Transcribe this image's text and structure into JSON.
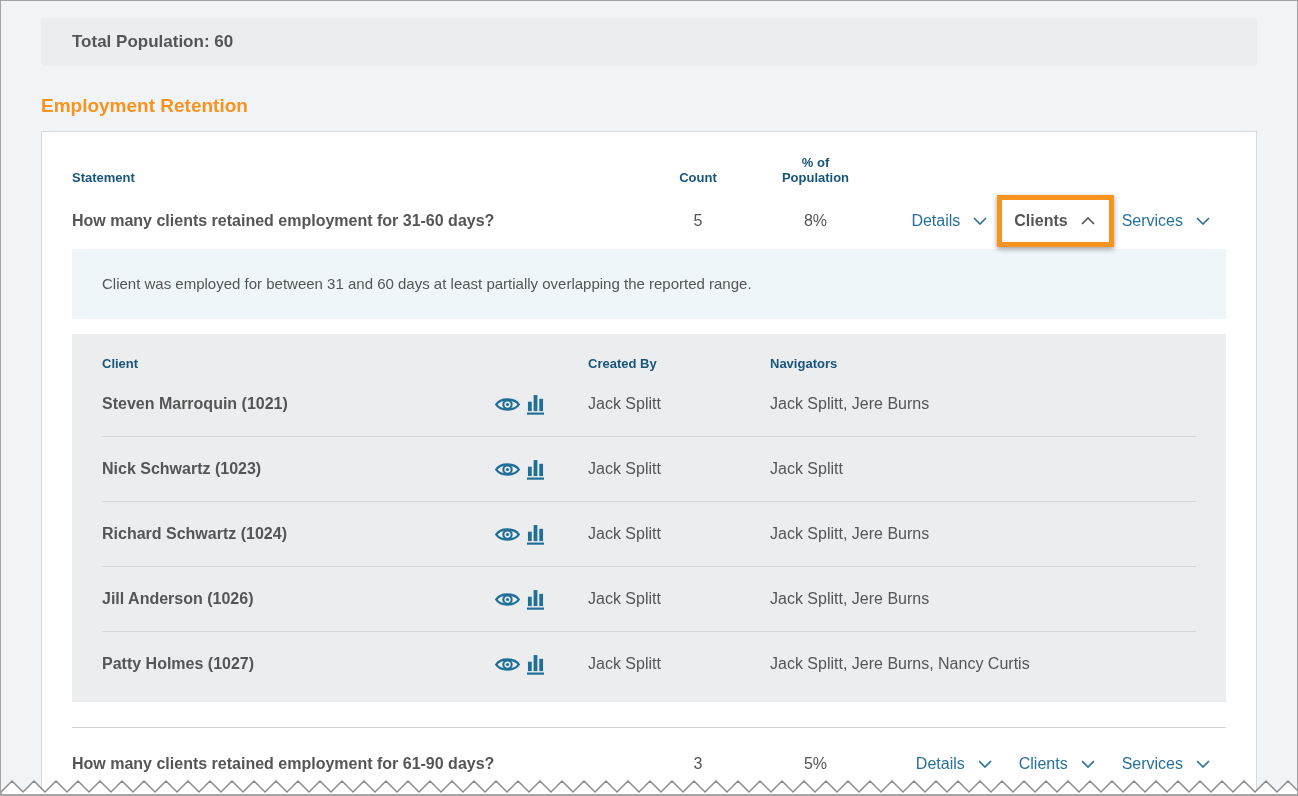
{
  "summary": {
    "label": "Total Population: 60"
  },
  "section_title": "Employment Retention",
  "columns": [
    "Statement",
    "Count",
    "% of Population"
  ],
  "statements": [
    {
      "text": "How many clients retained employment for 31-60 days?",
      "count": "5",
      "percent": "8%",
      "toggles": [
        {
          "label": "Details",
          "expanded": false,
          "highlighted": false
        },
        {
          "label": "Clients",
          "expanded": true,
          "highlighted": true
        },
        {
          "label": "Services",
          "expanded": false,
          "highlighted": false
        }
      ],
      "description": "Client was employed for between 31 and 60 days at least partially overlapping the reported range.",
      "clients": {
        "columns": [
          "Client",
          "Created By",
          "Navigators"
        ],
        "rows": [
          {
            "name": "Steven Marroquin (1021)",
            "created_by": "Jack Splitt",
            "navigators": "Jack Splitt, Jere Burns"
          },
          {
            "name": "Nick Schwartz (1023)",
            "created_by": "Jack Splitt",
            "navigators": "Jack Splitt"
          },
          {
            "name": "Richard Schwartz (1024)",
            "created_by": "Jack Splitt",
            "navigators": "Jack Splitt, Jere Burns"
          },
          {
            "name": "Jill Anderson (1026)",
            "created_by": "Jack Splitt",
            "navigators": "Jack Splitt, Jere Burns"
          },
          {
            "name": "Patty Holmes (1027)",
            "created_by": "Jack Splitt",
            "navigators": "Jack Splitt, Jere Burns, Nancy Curtis"
          }
        ]
      }
    },
    {
      "text": "How many clients retained employment for 61-90 days?",
      "count": "3",
      "percent": "5%",
      "toggles": [
        {
          "label": "Details",
          "expanded": false,
          "highlighted": false
        },
        {
          "label": "Clients",
          "expanded": false,
          "highlighted": false
        },
        {
          "label": "Services",
          "expanded": false,
          "highlighted": false
        }
      ]
    }
  ]
}
